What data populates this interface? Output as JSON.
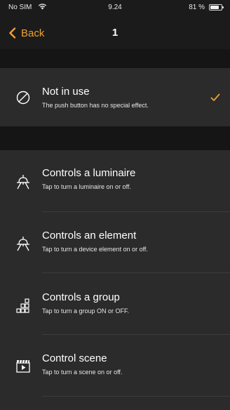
{
  "status_bar": {
    "carrier": "No SIM",
    "time": "9.24",
    "battery": "81 %",
    "battery_level": 0.81,
    "wifi_icon": "wifi-icon"
  },
  "nav": {
    "back_label": "Back",
    "back_icon": "chevron-left-icon",
    "title": "1"
  },
  "accent_color": "#f0a030",
  "selected_option": {
    "title": "Not in use",
    "subtitle": "The push button has no special effect.",
    "icon": "prohibited-icon",
    "checked": true,
    "check_icon": "checkmark-icon"
  },
  "options": [
    {
      "title": "Controls a luminaire",
      "subtitle": "Tap to turn a luminaire on or off.",
      "icon": "luminaire-icon"
    },
    {
      "title": "Controls an element",
      "subtitle": "Tap to turn a device element on or off.",
      "icon": "luminaire-icon"
    },
    {
      "title": "Controls a group",
      "subtitle": "Tap to turn a group ON or OFF.",
      "icon": "group-grid-icon"
    },
    {
      "title": "Control scene",
      "subtitle": "Tap to turn a scene on or off.",
      "icon": "scene-clapperboard-icon"
    }
  ]
}
